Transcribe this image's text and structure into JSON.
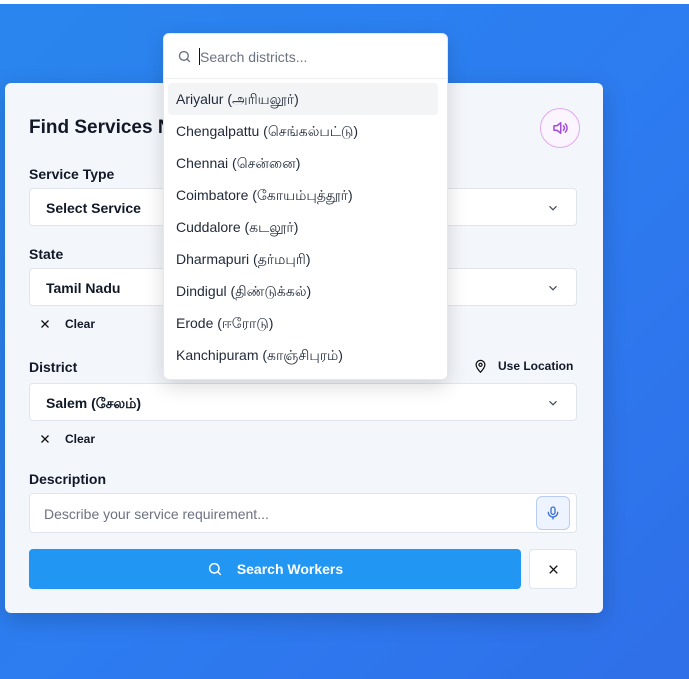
{
  "card": {
    "title": "Find Services N",
    "service_type": {
      "label": "Service Type",
      "value": "Select Service"
    },
    "state": {
      "label": "State",
      "value": "Tamil Nadu",
      "clear_label": "Clear"
    },
    "district": {
      "label": "District",
      "value": "Salem (சேலம்)",
      "clear_label": "Clear",
      "use_location_label": "Use Location"
    },
    "description": {
      "label": "Description",
      "placeholder": "Describe your service requirement..."
    },
    "search_button_label": "Search Workers"
  },
  "dropdown": {
    "search_placeholder": "Search districts...",
    "options": [
      "Ariyalur (அரியலூர்)",
      "Chengalpattu (செங்கல்பட்டு)",
      "Chennai (சென்னை)",
      "Coimbatore (கோயம்புத்தூர்)",
      "Cuddalore (கடலூர்)",
      "Dharmapuri (தர்மபுரி)",
      "Dindigul (திண்டுக்கல்)",
      "Erode (ஈரோடு)",
      "Kanchipuram (காஞ்சிபுரம்)"
    ],
    "highlighted_option": 0
  },
  "icons": {
    "speaker": "speaker-icon",
    "chevron": "chevron-down-icon",
    "close": "close-icon",
    "location": "map-pin-icon",
    "mic": "microphone-icon",
    "search": "search-icon"
  },
  "colors": {
    "background": "#2d7bf0",
    "primary_button": "#2196f3",
    "speaker_accent": "#a64bd6",
    "mic_accent": "#3b6fd8"
  }
}
